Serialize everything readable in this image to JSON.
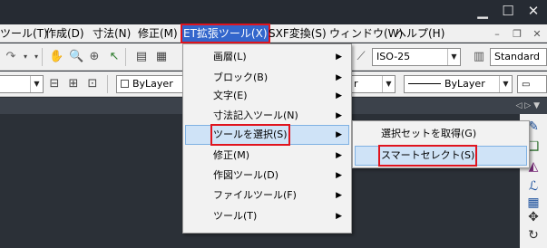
{
  "window_controls": {
    "minimize": "▁",
    "maximize": "☐",
    "close": "✕"
  },
  "mdi_controls": {
    "minimize": "–",
    "restore": "❐",
    "close": "✕"
  },
  "menubar": [
    {
      "label": "ツール(T)"
    },
    {
      "label": "作成(D)"
    },
    {
      "label": "寸法(N)"
    },
    {
      "label": "修正(M)"
    },
    {
      "label": "ET拡張ツール(X)"
    },
    {
      "label": "SXF変換(S)"
    },
    {
      "label": "ウィンドウ(W)"
    },
    {
      "label": "ヘルプ(H)"
    }
  ],
  "toolbar1": {
    "dimstyle_value": "ISO-25",
    "tablestyle_value": "Standard"
  },
  "toolbar2": {
    "color_value": "ByLayer",
    "color_partial": "r",
    "linetype_value": "ByLayer"
  },
  "dropdown": [
    {
      "label": "画層(L)"
    },
    {
      "label": "ブロック(B)"
    },
    {
      "label": "文字(E)"
    },
    {
      "label": "寸法記入ツール(N)"
    },
    {
      "label": "ツールを選択(S)"
    },
    {
      "label": "修正(M)"
    },
    {
      "label": "作図ツール(D)"
    },
    {
      "label": "ファイルツール(F)"
    },
    {
      "label": "ツール(T)"
    }
  ],
  "submenu": [
    {
      "label": "選択セットを取得(G)"
    },
    {
      "label": "スマートセレクト(S)"
    }
  ],
  "colors": {
    "accent": "#3366cc",
    "highlight_border": "#e0141e",
    "hover": "#cfe3f7"
  }
}
